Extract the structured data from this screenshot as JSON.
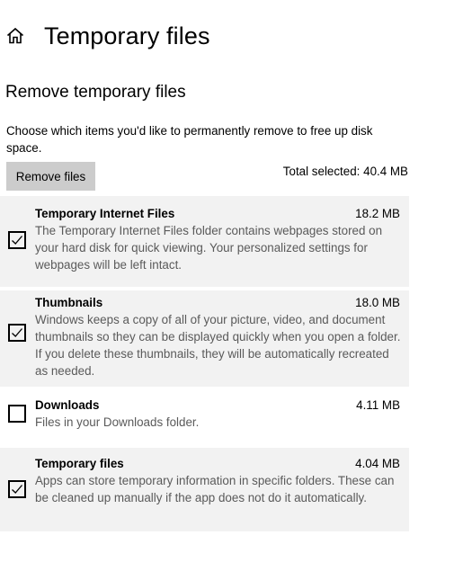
{
  "header": {
    "title": "Temporary files",
    "home_icon": "home-icon"
  },
  "section": {
    "title": "Remove temporary files",
    "description": "Choose which items you'd like to permanently remove to free up disk space."
  },
  "actions": {
    "remove_label": "Remove files",
    "total_selected": "Total selected: 40.4 MB"
  },
  "items": [
    {
      "name": "Temporary Internet Files",
      "size": "18.2 MB",
      "description": "The Temporary Internet Files folder contains webpages stored on your hard disk for quick viewing. Your personalized settings for webpages will be left intact.",
      "checked": true
    },
    {
      "name": "Thumbnails",
      "size": "18.0 MB",
      "description": "Windows keeps a copy of all of your picture, video, and document thumbnails so they can be displayed quickly when you open a folder. If you delete these thumbnails, they will be automatically recreated as needed.",
      "checked": true
    },
    {
      "name": "Downloads",
      "size": "4.11 MB",
      "description": "Files in your Downloads folder.",
      "checked": false
    },
    {
      "name": "Temporary files",
      "size": "4.04 MB",
      "description": "Apps can store temporary information in specific folders. These can be cleaned up manually if the app does not do it automatically.",
      "checked": true
    }
  ],
  "colors": {
    "shaded_row": "#f2f2f2",
    "button_bg": "#cccccc",
    "secondary_text": "#5a5a5a"
  }
}
